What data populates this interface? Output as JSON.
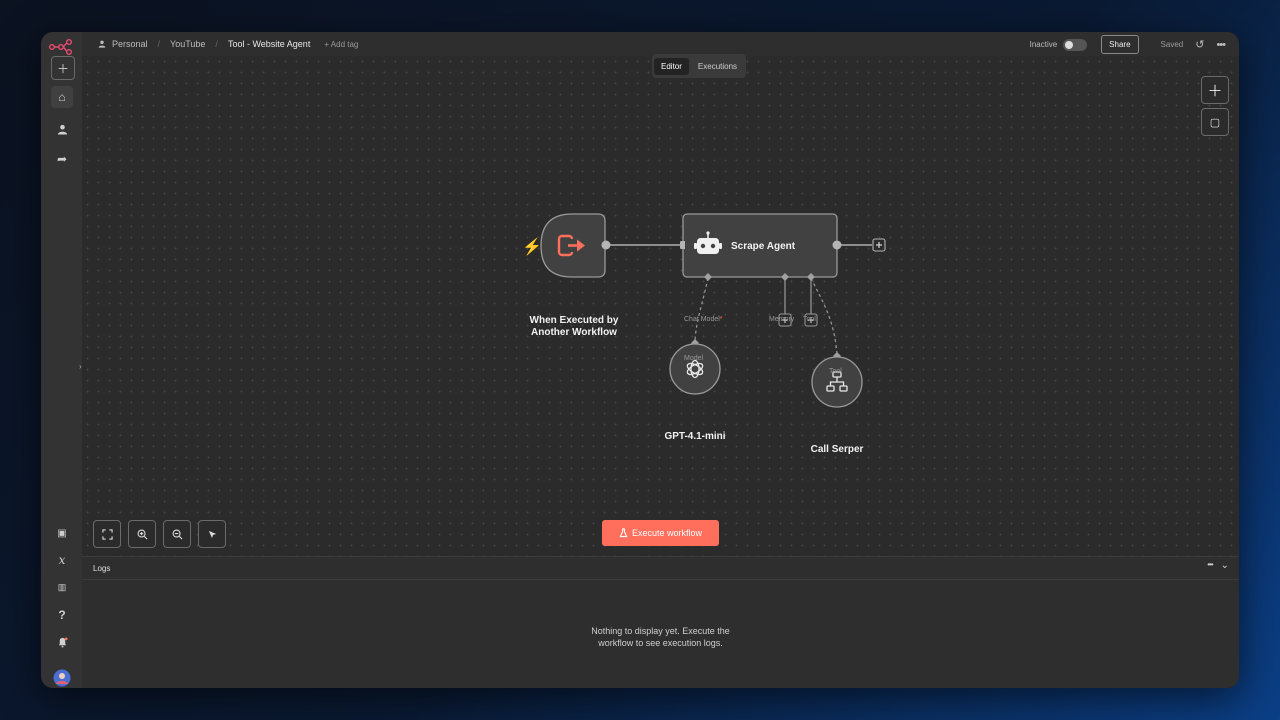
{
  "topbar": {
    "breadcrumb": {
      "project": "Personal",
      "folder": "YouTube",
      "workflow": "Tool - Website Agent"
    },
    "add_tag": "+ Add tag",
    "status": "Inactive",
    "share_label": "Share",
    "saved_label": "Saved"
  },
  "tabs": [
    {
      "label": "Editor",
      "active": true
    },
    {
      "label": "Executions",
      "active": false
    }
  ],
  "nodes": {
    "trigger": {
      "title_line1": "When Executed by",
      "title_line2": "Another Workflow"
    },
    "agent": {
      "title": "Scrape Agent",
      "ports": {
        "chat_model": "Chat Model",
        "memory": "Memory",
        "tool": "Tool"
      }
    },
    "model": {
      "title": "GPT-4.1-mini",
      "port": "Model"
    },
    "tool": {
      "title": "Call Serper",
      "port": "Tool"
    }
  },
  "execute_button": "Execute workflow",
  "logs": {
    "title": "Logs",
    "empty_line1": "Nothing to display yet. Execute the",
    "empty_line2": "workflow to see execution logs."
  },
  "colors": {
    "accent": "#ff6f5c",
    "canvas": "#2b2b2b",
    "node_fill": "#414141",
    "node_border": "#9a9a9a"
  },
  "icons": {
    "sidebar": [
      "plus-icon",
      "home-icon",
      "user-icon",
      "share-icon",
      "templates-icon",
      "variables-icon",
      "insights-icon",
      "help-icon",
      "bell-icon",
      "avatar"
    ],
    "canvas_tools": [
      "fit-view-icon",
      "zoom-in-icon",
      "zoom-out-icon",
      "tidy-up-icon"
    ]
  }
}
